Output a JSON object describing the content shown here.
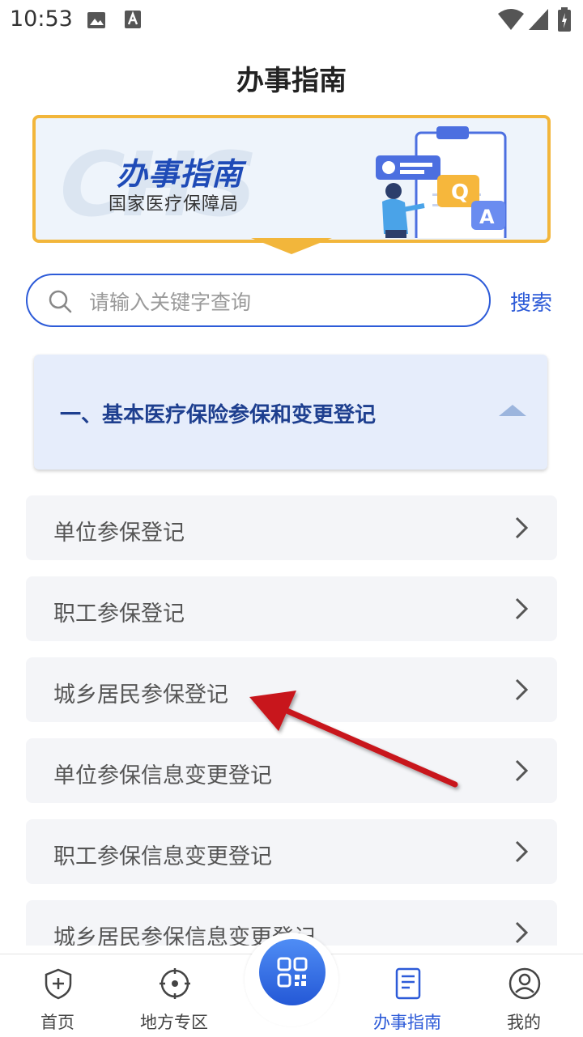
{
  "status_bar": {
    "time": "10:53"
  },
  "header": {
    "title": "办事指南"
  },
  "banner": {
    "watermark": "CHS",
    "title": "办事指南",
    "subtitle": "国家医疗保障局",
    "illustration_letters": [
      "Q",
      "A"
    ]
  },
  "search": {
    "placeholder": "请输入关键字查询",
    "value": "",
    "button_label": "搜索"
  },
  "section": {
    "title": "一、基本医疗保险参保和变更登记",
    "expanded": true
  },
  "items": [
    {
      "label": "单位参保登记"
    },
    {
      "label": "职工参保登记"
    },
    {
      "label": "城乡居民参保登记"
    },
    {
      "label": "单位参保信息变更登记"
    },
    {
      "label": "职工参保信息变更登记"
    },
    {
      "label": "城乡居民参保信息变更登记"
    }
  ],
  "bottom_nav": [
    {
      "label": "首页",
      "icon": "shield-plus-icon",
      "active": false
    },
    {
      "label": "地方专区",
      "icon": "target-icon",
      "active": false
    },
    {
      "label": "办事指南",
      "icon": "document-icon",
      "active": true
    },
    {
      "label": "我的",
      "icon": "person-icon",
      "active": false
    }
  ],
  "colors": {
    "accent": "#2d5bd8",
    "banner_border": "#f2b63b",
    "section_bg": "#e6edfb",
    "annotation": "#c8161d"
  }
}
